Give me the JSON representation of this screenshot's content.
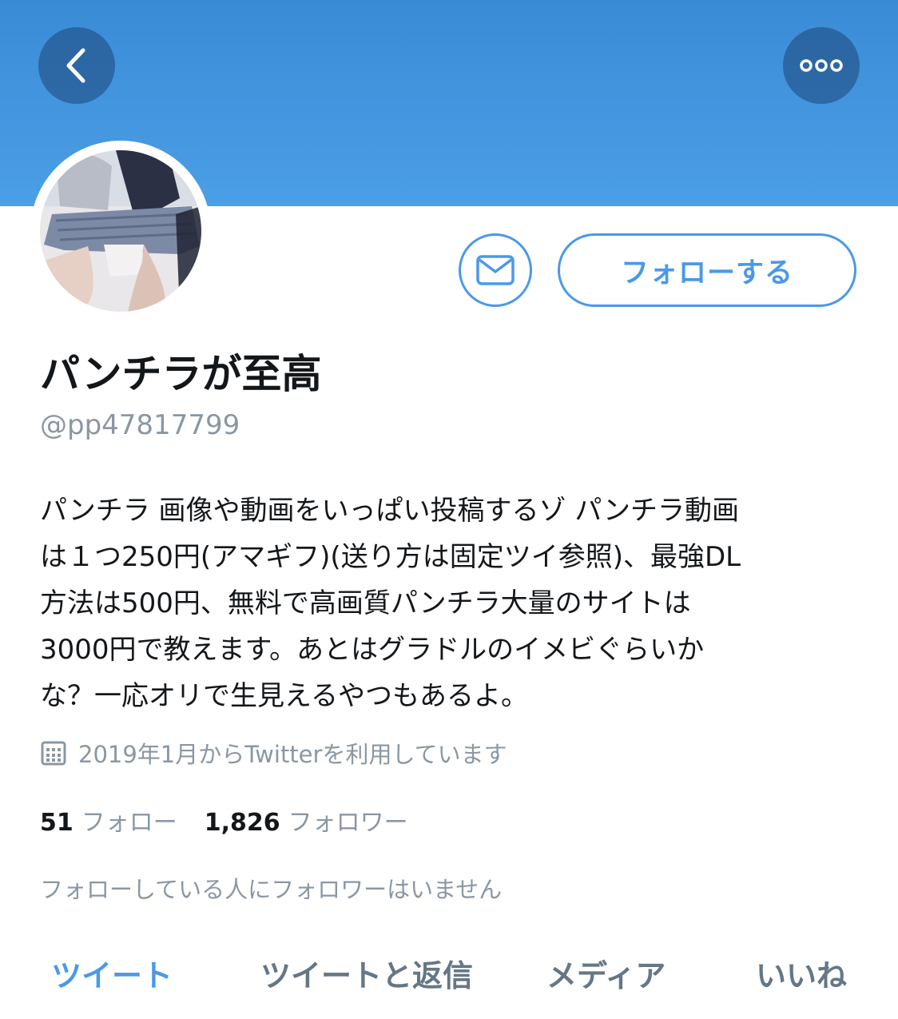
{
  "profile": {
    "display_name": "パンチラが至高",
    "handle": "@pp47817799",
    "bio_lines": [
      "パンチラ 画像や動画をいっぱい投稿するゾ パンチラ動画",
      "は１つ250円(アマギフ)(送り方は固定ツイ参照)、最強DL",
      "方法は500円、無料で高画質パンチラ大量のサイトは",
      "3000円で教えます。あとはグラドルのイメビぐらいか",
      "な？一応オリで生見えるやつもあるよ。"
    ],
    "joined": "2019年1月からTwitterを利用しています",
    "following_count": "51",
    "following_label": "フォロー",
    "followers_count": "1,826",
    "followers_label": "フォロワー",
    "followed_by_note": "フォローしている人にフォロワーはいません"
  },
  "actions": {
    "follow_label": "フォローする",
    "message_icon": "envelope-icon",
    "back_icon": "chevron-left-icon",
    "more_icon": "more-dots-icon"
  },
  "tabs": [
    {
      "label": "ツイート",
      "active": true
    },
    {
      "label": "ツイートと返信",
      "active": false
    },
    {
      "label": "メディア",
      "active": false
    },
    {
      "label": "いいね",
      "active": false
    }
  ],
  "colors": {
    "accent": "#4a99e9",
    "banner": "#4b9fe6",
    "muted_text": "#8a97a3",
    "primary_text": "#14171a"
  }
}
